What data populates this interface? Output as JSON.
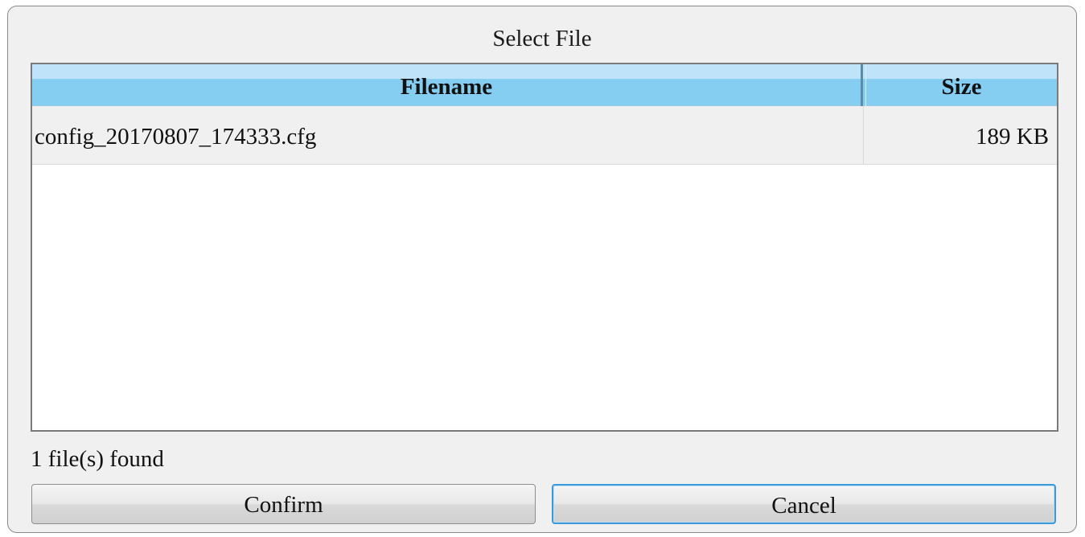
{
  "dialog": {
    "title": "Select File"
  },
  "file_list": {
    "columns": {
      "filename": "Filename",
      "size": "Size"
    },
    "rows": [
      {
        "filename": "config_20170807_174333.cfg",
        "size": "189 KB"
      }
    ]
  },
  "status": {
    "text": "1 file(s) found"
  },
  "buttons": {
    "confirm": "Confirm",
    "cancel": "Cancel"
  },
  "colors": {
    "header_light": "#bfe4fa",
    "header_dark": "#86cdf2",
    "focus_border": "#3c9ad8"
  }
}
